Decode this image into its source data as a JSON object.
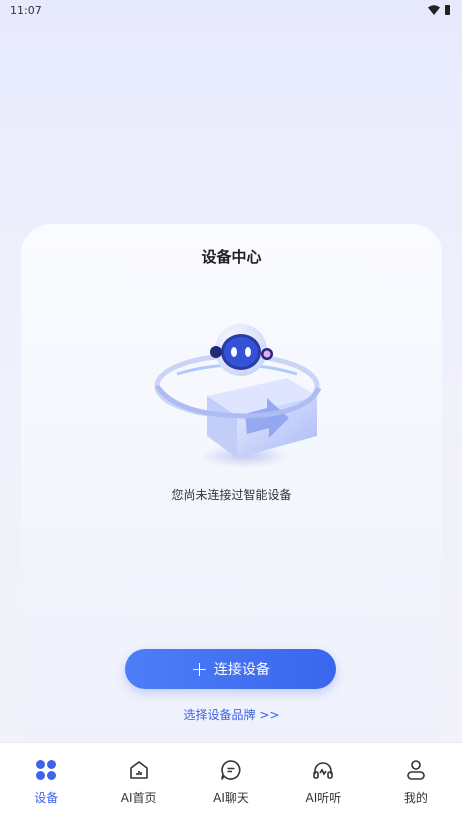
{
  "status_bar": {
    "time": "11:07"
  },
  "card": {
    "title": "设备中心",
    "empty_message": "您尚未连接过智能设备",
    "connect_button_label": "连接设备",
    "brand_link_label": "选择设备品牌 >>"
  },
  "tabbar": {
    "items": [
      {
        "label": "设备",
        "icon": "devices-grid-icon"
      },
      {
        "label": "AI首页",
        "icon": "home-icon"
      },
      {
        "label": "AI聊天",
        "icon": "chat-icon"
      },
      {
        "label": "AI听听",
        "icon": "headphones-icon"
      },
      {
        "label": "我的",
        "icon": "user-icon"
      }
    ],
    "active_index": 0
  },
  "colors": {
    "accent": "#3d63e8",
    "button": "#4071f0"
  }
}
